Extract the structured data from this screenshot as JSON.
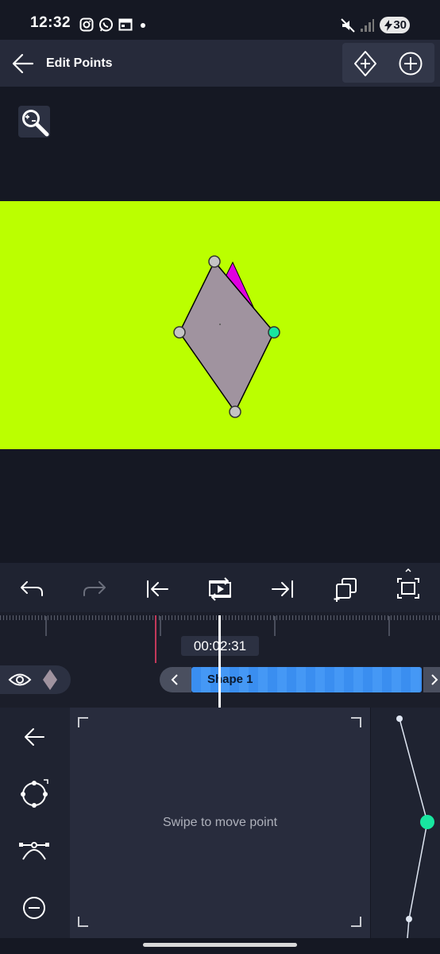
{
  "status_bar": {
    "time": "12:32",
    "battery": "30"
  },
  "header": {
    "title": "Edit Points"
  },
  "timeline": {
    "timecode": "00:02:31",
    "clip_label": "Shape 1"
  },
  "pad": {
    "hint": "Swipe to move point"
  },
  "colors": {
    "canvas_bg": "#bbff00",
    "shape_fill": "#a0939f",
    "magenta_shape": "#e000e0",
    "selected_point": "#18e6a0",
    "clip_blue": "#3a8ef0"
  },
  "icons": {
    "header": [
      "back-arrow-icon",
      "add-keyframe-diamond-icon",
      "add-point-icon"
    ],
    "toolbar": [
      "undo-icon",
      "redo-icon",
      "jump-start-icon",
      "loop-play-icon",
      "jump-end-icon",
      "duplicate-icon",
      "fit-frame-icon"
    ],
    "left_panel": [
      "back-icon",
      "curve-point-icon",
      "bezier-handle-icon",
      "remove-point-icon"
    ]
  }
}
